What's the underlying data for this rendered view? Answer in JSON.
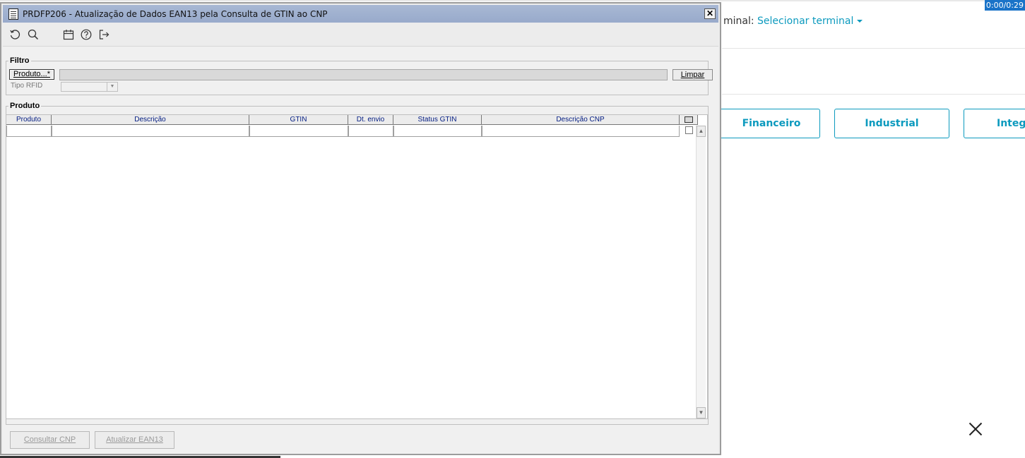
{
  "background_app": {
    "terminal_label": "minal:",
    "terminal_select": "Selecionar terminal",
    "modules": [
      "Financeiro",
      "Industrial",
      "Integr"
    ],
    "timer": "0:00/0:29"
  },
  "window": {
    "title": "PRDFP206 - Atualização de Dados EAN13 pela Consulta de GTIN ao CNP",
    "close_label": "✕",
    "toolbar_icons": [
      "refresh-icon",
      "search-icon",
      "calendar-icon",
      "help-icon",
      "exit-icon"
    ]
  },
  "filtro": {
    "legend": "Filtro",
    "produto_button": "Produto...*",
    "produto_value": "",
    "limpar_button": "Limpar",
    "tipo_rfid_label": "Tipo RFID",
    "tipo_rfid_value": ""
  },
  "produto_grid": {
    "legend": "Produto",
    "columns": [
      "Produto",
      "Descrição",
      "GTIN",
      "Dt. envio",
      "Status GTIN",
      "Descrição CNP"
    ],
    "rows": [
      [
        "",
        "",
        "",
        "",
        "",
        ""
      ]
    ]
  },
  "footer": {
    "consultar_button": "Consultar CNP",
    "atualizar_button": "Atualizar EAN13"
  },
  "colors": {
    "accent": "#0c9abe",
    "titlebar": "#a2b3d1",
    "timer_bg": "#1a73c8"
  }
}
